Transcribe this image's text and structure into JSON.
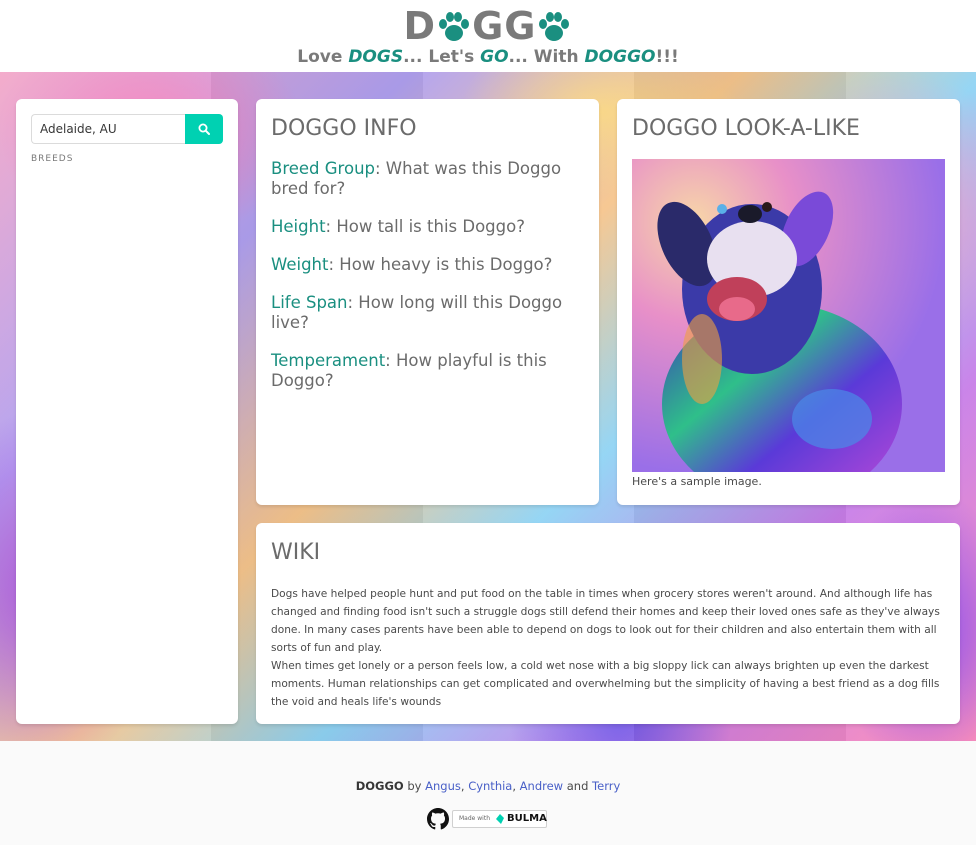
{
  "header": {
    "logo_text_parts": [
      "D",
      "GG"
    ],
    "tagline": {
      "w1": "Love ",
      "h1": "DOGS",
      "w2": "... Let's ",
      "h2": "GO",
      "w3": "... With ",
      "h3": "DOGGO",
      "w4": "!!!"
    }
  },
  "sidebar": {
    "search_value": "Adelaide, AU",
    "breeds_label": "BREEDS"
  },
  "info": {
    "title": "DOGGO INFO",
    "items": [
      {
        "key": "Breed Group",
        "text": ": What was this Doggo bred for?"
      },
      {
        "key": "Height",
        "text": ": How tall is this Doggo?"
      },
      {
        "key": "Weight",
        "text": ": How heavy is this Doggo?"
      },
      {
        "key": "Life Span",
        "text": ": How long will this Doggo live?"
      },
      {
        "key": "Temperament",
        "text": ": How playful is this Doggo?"
      }
    ]
  },
  "lookalike": {
    "title": "DOGGO LOOK-A-LIKE",
    "caption": "Here's a sample image."
  },
  "wiki": {
    "title": "WIKI",
    "p1": "Dogs have helped people hunt and put food on the table in times when grocery stores weren't around. And although life has changed and finding food isn't such a struggle dogs still defend their homes and keep their loved ones safe as they've always done. In many cases parents have been able to depend on dogs to look out for their children and also entertain them with all sorts of fun and play.",
    "p2": "When times get lonely or a person feels low, a cold wet nose with a big sloppy lick can always brighten up even the darkest moments. Human relationships can get complicated and overwhelming but the simplicity of having a best friend as a dog fills the void and heals life's wounds"
  },
  "footer": {
    "brand": "DOGGO",
    "by": " by ",
    "authors": [
      "Angus",
      "Cynthia",
      "Andrew",
      "Terry"
    ],
    "sep1": ", ",
    "sep2": ", ",
    "and": " and ",
    "made_with": "Made with",
    "bulma": "BULMA"
  },
  "colors": {
    "accent": "#1a8f80",
    "button": "#00d1b2",
    "link": "#485fc7"
  }
}
